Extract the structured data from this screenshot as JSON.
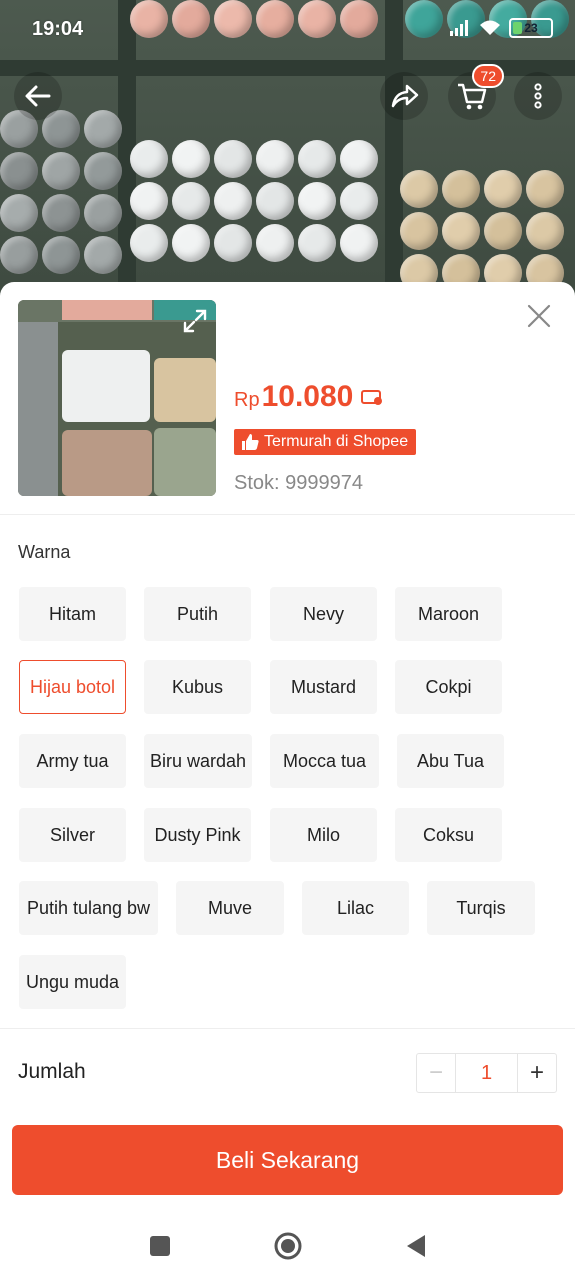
{
  "status_bar": {
    "time": "19:04",
    "battery": "23"
  },
  "nav": {
    "cart_count": "72"
  },
  "product": {
    "price_currency": "Rp",
    "price_value": "10.080",
    "badge_label": "Termurah di Shopee",
    "stock": "Stok: 9999974"
  },
  "variations": {
    "label": "Warna",
    "options": [
      "Hitam",
      "Putih",
      "Nevy",
      "Maroon",
      "Hijau botol",
      "Kubus",
      "Mustard",
      "Cokpi",
      "Army tua",
      "Biru wardah",
      "Mocca tua",
      "Abu Tua",
      "Silver",
      "Dusty Pink",
      "Milo",
      "Coksu",
      "Putih tulang bw",
      "Muve",
      "Lilac",
      "Turqis",
      "Ungu muda"
    ],
    "selected": "Hijau botol"
  },
  "quantity": {
    "label": "Jumlah",
    "value": "1",
    "minus": "−",
    "plus": "+"
  },
  "buy_button": "Beli Sekarang",
  "colors": {
    "accent": "#ee4d2d"
  }
}
